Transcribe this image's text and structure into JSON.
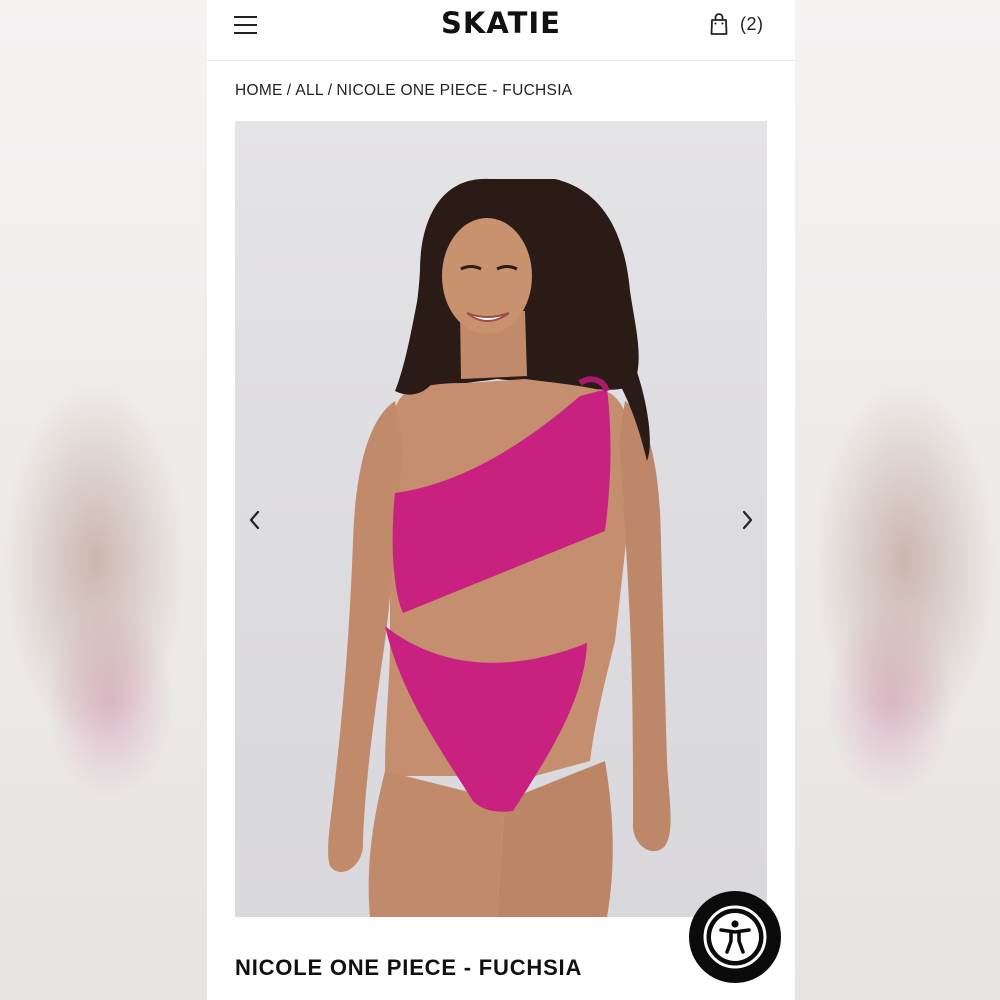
{
  "header": {
    "logo": "SKATIE",
    "menu_icon": "hamburger-menu-icon",
    "cart_icon": "shopping-bag-icon",
    "cart_count": "(2)"
  },
  "breadcrumb": {
    "items": [
      "HOME",
      "ALL",
      "NICOLE ONE PIECE - FUCHSIA"
    ],
    "separator": "/"
  },
  "gallery": {
    "prev_icon": "chevron-left-icon",
    "next_icon": "chevron-right-icon"
  },
  "product": {
    "title": "NICOLE ONE PIECE - FUCHSIA",
    "swimsuit_color": "#c8217f"
  },
  "accessibility_widget": {
    "icon": "accessibility-person-icon"
  }
}
